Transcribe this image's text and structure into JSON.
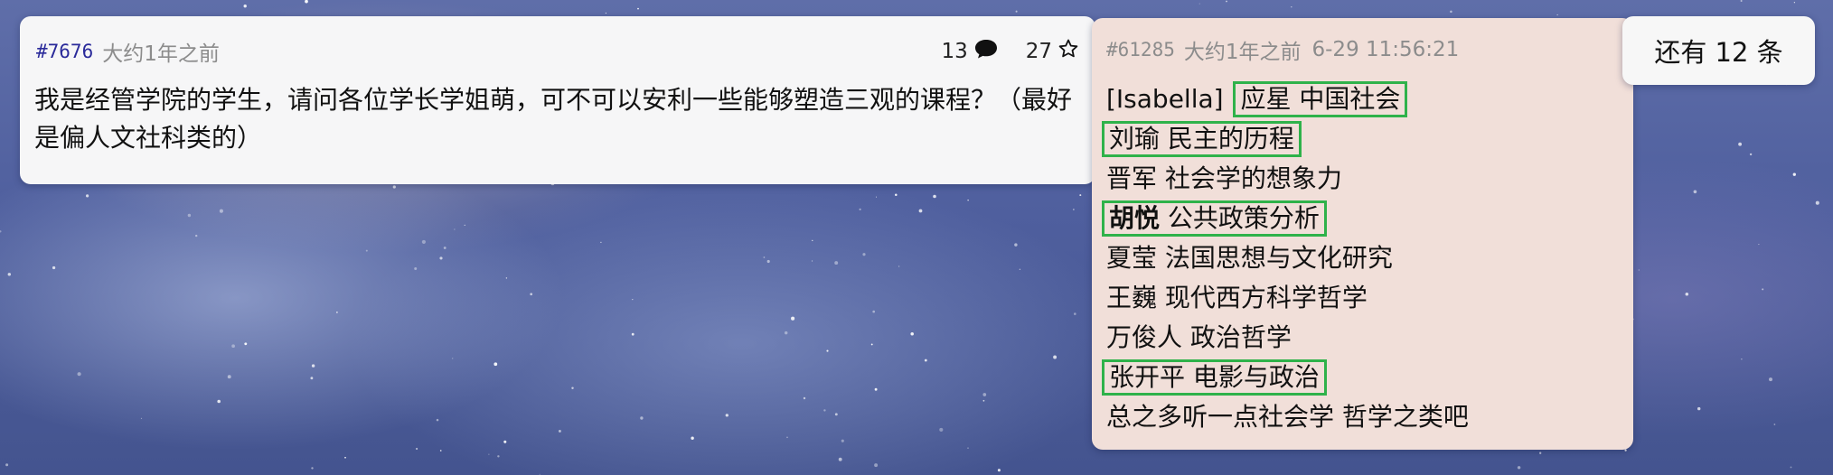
{
  "post": {
    "id": "#7676",
    "time": "大约1年之前",
    "reply_count": "13",
    "star_count": "27",
    "body": "我是经管学院的学生，请问各位学长学姐萌，可不可以安利一些能够塑造三观的课程？（最好是偏人文社科类的）"
  },
  "reply": {
    "id": "#61285",
    "time": "大约1年之前",
    "timestamp": "6-29 11:56:21",
    "lines": [
      {
        "prefix": "[Isabella] ",
        "text": "应星  中国社会"
      },
      {
        "text": "刘瑜  民主的历程"
      },
      {
        "text": "晋军  社会学的想象力"
      },
      {
        "bold": "胡悦",
        "text": "  公共政策分析"
      },
      {
        "text": "夏莹  法国思想与文化研究"
      },
      {
        "text": "王巍  现代西方科学哲学"
      },
      {
        "text": "万俊人  政治哲学"
      },
      {
        "text": "张开平  电影与政治"
      },
      {
        "text": "总之多听一点社会学 哲学之类吧"
      }
    ]
  },
  "more_button": {
    "label": "还有 12 条"
  },
  "colors": {
    "highlight": "#2fb24a",
    "reply_bg": "#f1dfd9",
    "post_id": "#2a2a9a"
  },
  "icons": {
    "comment": "comment-bubble-icon",
    "star": "star-outline-icon"
  }
}
